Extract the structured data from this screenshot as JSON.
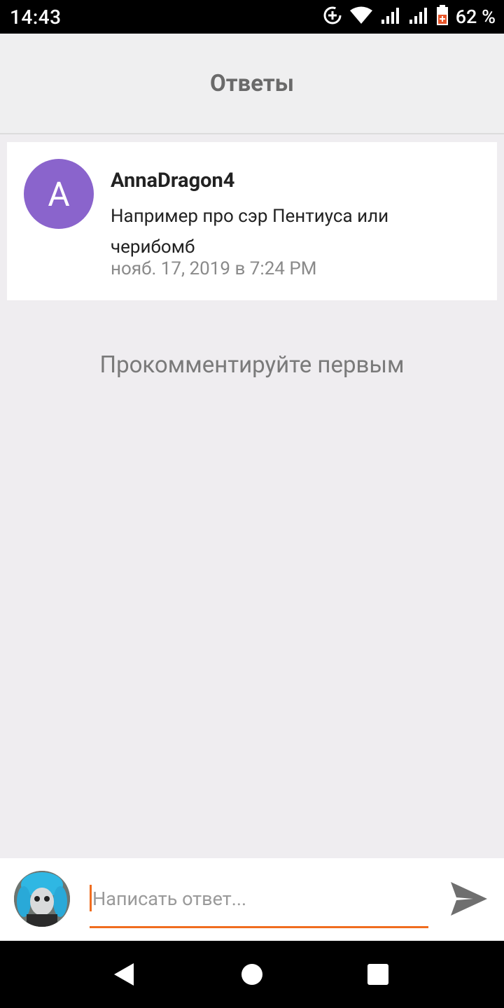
{
  "status_bar": {
    "time": "14:43",
    "battery_percent": "62 %",
    "icons": [
      "data-saver-icon",
      "wifi-icon",
      "signal-icon",
      "signal-icon",
      "battery-icon"
    ]
  },
  "header": {
    "title": "Ответы"
  },
  "reply": {
    "avatar_letter": "A",
    "avatar_color": "#8a64cc",
    "author": "AnnaDragon4",
    "text": "Например про сэр Пентиуса или черибомб",
    "date": "нояб. 17, 2019 в 7:24 PM"
  },
  "empty_state": {
    "text": "Прокомментируйте первым"
  },
  "composer": {
    "placeholder": "Написать ответ...",
    "value": "",
    "accent_color": "#f06d1f"
  },
  "nav": {
    "icons": [
      "back-icon",
      "home-icon",
      "recents-icon"
    ]
  }
}
